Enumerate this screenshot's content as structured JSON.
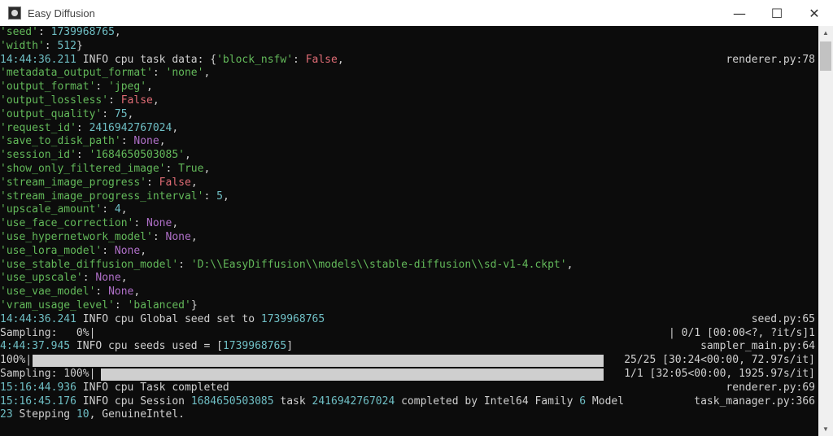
{
  "window": {
    "title": "Easy Diffusion",
    "minimize": "—",
    "maximize": "☐",
    "close": "✕"
  },
  "console": {
    "lines": [
      [
        {
          "t": "'seed'",
          "c": "g"
        },
        {
          "t": ": ",
          "c": "w"
        },
        {
          "t": "1739968765",
          "c": "n"
        },
        {
          "t": ",",
          "c": "w"
        }
      ],
      [
        {
          "t": "'width'",
          "c": "g"
        },
        {
          "t": ": ",
          "c": "w"
        },
        {
          "t": "512",
          "c": "n"
        },
        {
          "t": "}",
          "c": "w"
        }
      ],
      [
        {
          "t": "14:44:36.211",
          "c": "t"
        },
        {
          "t": " INFO cpu task data: {",
          "c": "w"
        },
        {
          "t": "'block_nsfw'",
          "c": "g"
        },
        {
          "t": ": ",
          "c": "w"
        },
        {
          "t": "False",
          "c": "r"
        },
        {
          "t": ",",
          "c": "w"
        },
        {
          "right": "renderer.py:78"
        }
      ],
      [
        {
          "t": "'metadata_output_format'",
          "c": "g"
        },
        {
          "t": ": ",
          "c": "w"
        },
        {
          "t": "'none'",
          "c": "g"
        },
        {
          "t": ",",
          "c": "w"
        }
      ],
      [
        {
          "t": "'output_format'",
          "c": "g"
        },
        {
          "t": ": ",
          "c": "w"
        },
        {
          "t": "'jpeg'",
          "c": "g"
        },
        {
          "t": ",",
          "c": "w"
        }
      ],
      [
        {
          "t": "'output_lossless'",
          "c": "g"
        },
        {
          "t": ": ",
          "c": "w"
        },
        {
          "t": "False",
          "c": "r"
        },
        {
          "t": ",",
          "c": "w"
        }
      ],
      [
        {
          "t": "'output_quality'",
          "c": "g"
        },
        {
          "t": ": ",
          "c": "w"
        },
        {
          "t": "75",
          "c": "n"
        },
        {
          "t": ",",
          "c": "w"
        }
      ],
      [
        {
          "t": "'request_id'",
          "c": "g"
        },
        {
          "t": ": ",
          "c": "w"
        },
        {
          "t": "2416942767024",
          "c": "n"
        },
        {
          "t": ",",
          "c": "w"
        }
      ],
      [
        {
          "t": "'save_to_disk_path'",
          "c": "g"
        },
        {
          "t": ": ",
          "c": "w"
        },
        {
          "t": "None",
          "c": "p"
        },
        {
          "t": ",",
          "c": "w"
        }
      ],
      [
        {
          "t": "'session_id'",
          "c": "g"
        },
        {
          "t": ": ",
          "c": "w"
        },
        {
          "t": "'1684650503085'",
          "c": "g"
        },
        {
          "t": ",",
          "c": "w"
        }
      ],
      [
        {
          "t": "'show_only_filtered_image'",
          "c": "g"
        },
        {
          "t": ": ",
          "c": "w"
        },
        {
          "t": "True",
          "c": "g"
        },
        {
          "t": ",",
          "c": "w"
        }
      ],
      [
        {
          "t": "'stream_image_progress'",
          "c": "g"
        },
        {
          "t": ": ",
          "c": "w"
        },
        {
          "t": "False",
          "c": "r"
        },
        {
          "t": ",",
          "c": "w"
        }
      ],
      [
        {
          "t": "'stream_image_progress_interval'",
          "c": "g"
        },
        {
          "t": ": ",
          "c": "w"
        },
        {
          "t": "5",
          "c": "n"
        },
        {
          "t": ",",
          "c": "w"
        }
      ],
      [
        {
          "t": "'upscale_amount'",
          "c": "g"
        },
        {
          "t": ": ",
          "c": "w"
        },
        {
          "t": "4",
          "c": "n"
        },
        {
          "t": ",",
          "c": "w"
        }
      ],
      [
        {
          "t": "'use_face_correction'",
          "c": "g"
        },
        {
          "t": ": ",
          "c": "w"
        },
        {
          "t": "None",
          "c": "p"
        },
        {
          "t": ",",
          "c": "w"
        }
      ],
      [
        {
          "t": "'use_hypernetwork_model'",
          "c": "g"
        },
        {
          "t": ": ",
          "c": "w"
        },
        {
          "t": "None",
          "c": "p"
        },
        {
          "t": ",",
          "c": "w"
        }
      ],
      [
        {
          "t": "'use_lora_model'",
          "c": "g"
        },
        {
          "t": ": ",
          "c": "w"
        },
        {
          "t": "None",
          "c": "p"
        },
        {
          "t": ",",
          "c": "w"
        }
      ],
      [
        {
          "t": "'use_stable_diffusion_model'",
          "c": "g"
        },
        {
          "t": ": ",
          "c": "w"
        },
        {
          "t": "'D:\\\\EasyDiffusion\\\\models\\\\stable-diffusion\\\\sd-v1-4.ckpt'",
          "c": "g"
        },
        {
          "t": ",",
          "c": "w"
        }
      ],
      [
        {
          "t": "'use_upscale'",
          "c": "g"
        },
        {
          "t": ": ",
          "c": "w"
        },
        {
          "t": "None",
          "c": "p"
        },
        {
          "t": ",",
          "c": "w"
        }
      ],
      [
        {
          "t": "'use_vae_model'",
          "c": "g"
        },
        {
          "t": ": ",
          "c": "w"
        },
        {
          "t": "None",
          "c": "p"
        },
        {
          "t": ",",
          "c": "w"
        }
      ],
      [
        {
          "t": "'vram_usage_level'",
          "c": "g"
        },
        {
          "t": ": ",
          "c": "w"
        },
        {
          "t": "'balanced'",
          "c": "g"
        },
        {
          "t": "}",
          "c": "w"
        }
      ],
      [
        {
          "t": "14:44:36.241",
          "c": "t"
        },
        {
          "t": " INFO cpu Global seed set to ",
          "c": "w"
        },
        {
          "t": "1739968765",
          "c": "n"
        },
        {
          "right": "seed.py:65"
        }
      ],
      [
        {
          "t": "Sampling:   0%|",
          "c": "w"
        },
        {
          "right": "| 0/1 [00:00<?, ?it/s]1"
        }
      ],
      [
        {
          "t": "4:44:37.945",
          "c": "t"
        },
        {
          "t": " INFO cpu seeds used = [",
          "c": "w"
        },
        {
          "t": "1739968765",
          "c": "n"
        },
        {
          "t": "]",
          "c": "w"
        },
        {
          "right": "sampler_main.py:64"
        }
      ],
      [
        {
          "t": "100%|",
          "c": "w"
        },
        {
          "progress": 1.0
        },
        {
          "right": "25/25 [30:24<00:00, 72.97s/it]"
        }
      ],
      [
        {
          "t": "Sampling: 100%|",
          "c": "w"
        },
        {
          "progress": 1.0
        },
        {
          "right": "1/1 [32:05<00:00, 1925.97s/it]"
        }
      ],
      [
        {
          "t": "15:16:44.936",
          "c": "t"
        },
        {
          "t": " INFO cpu Task completed",
          "c": "w"
        },
        {
          "right": "renderer.py:69"
        }
      ],
      [
        {
          "t": "15:16:45.176",
          "c": "t"
        },
        {
          "t": " INFO cpu Session ",
          "c": "w"
        },
        {
          "t": "1684650503085",
          "c": "n"
        },
        {
          "t": " task ",
          "c": "w"
        },
        {
          "t": "2416942767024",
          "c": "n"
        },
        {
          "t": " completed by Intel64 Family ",
          "c": "w"
        },
        {
          "t": "6",
          "c": "n"
        },
        {
          "t": " Model",
          "c": "w"
        },
        {
          "right": "task_manager.py:366"
        }
      ],
      [
        {
          "t": "23",
          "c": "n"
        },
        {
          "t": " Stepping ",
          "c": "w"
        },
        {
          "t": "10",
          "c": "n"
        },
        {
          "t": ", GenuineIntel.",
          "c": "w"
        }
      ]
    ]
  },
  "scrollbar": {
    "up": "▲",
    "down": "▼"
  }
}
